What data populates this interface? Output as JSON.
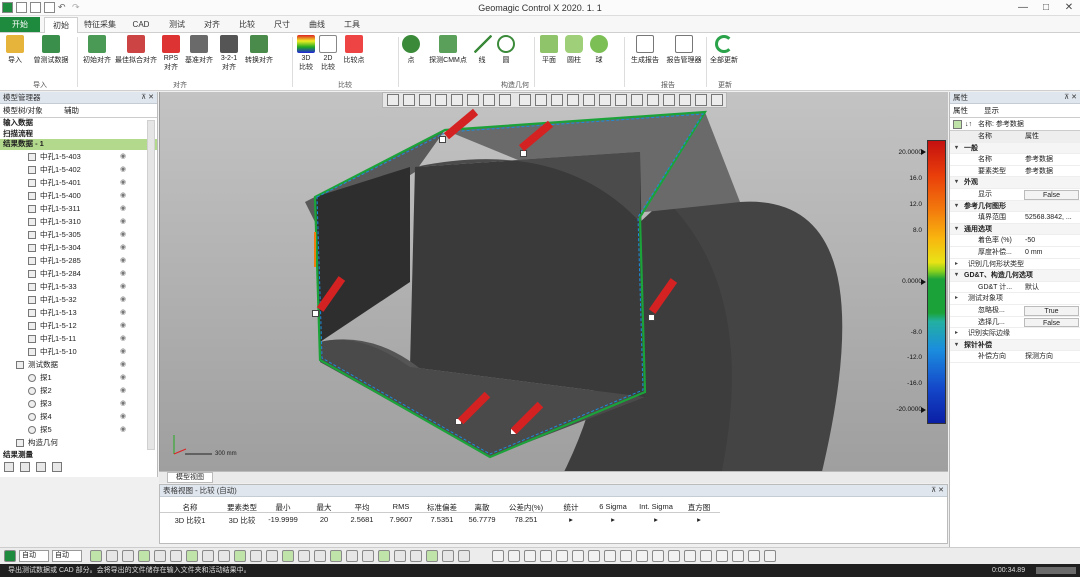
{
  "app": {
    "title": "Geomagic Control X 2020. 1. 1"
  },
  "menu": {
    "tabs": [
      "开始",
      "初始",
      "特征采集",
      "CAD",
      "测试",
      "对齐",
      "比较",
      "尺寸",
      "曲线",
      "工具"
    ],
    "active": "初始"
  },
  "ribbon": {
    "buttons": [
      {
        "label": "导入"
      },
      {
        "label": "曾测试数据"
      },
      {
        "label": "初始对齐"
      },
      {
        "label": "最佳拟合对齐"
      },
      {
        "label": "RPS\n对齐"
      },
      {
        "label": "基准对齐"
      },
      {
        "label": "3-2-1\n对齐"
      },
      {
        "label": "转换对齐"
      },
      {
        "label": "3D\n比较"
      },
      {
        "label": "2D\n比较"
      },
      {
        "label": "比较点"
      },
      {
        "label": "点"
      },
      {
        "label": "探测CMM点"
      },
      {
        "label": "线"
      },
      {
        "label": "圆"
      },
      {
        "label": "平面"
      },
      {
        "label": "圆柱"
      },
      {
        "label": "球"
      },
      {
        "label": "生成报告"
      },
      {
        "label": "报告管理器"
      },
      {
        "label": "全部更新"
      }
    ],
    "groups": [
      "导入",
      "对齐",
      "比较",
      "构造几何",
      "报告",
      "更新"
    ]
  },
  "left_panel": {
    "title": "模型管理器",
    "tab_model": "模型树/对象",
    "tab_assist": "辅助",
    "sections": {
      "input": "输入数据",
      "scan": "扫描流程",
      "result": "结果数据 - 1"
    },
    "items": [
      "中孔1-5-403",
      "中孔1-5-402",
      "中孔1-5-401",
      "中孔1-5-400",
      "中孔1-5-311",
      "中孔1-5-310",
      "中孔1-5-305",
      "中孔1-5-304",
      "中孔1-5-285",
      "中孔1-5-284",
      "中孔1-5-33",
      "中孔1-5-32",
      "中孔1-5-13",
      "中孔1-5-12",
      "中孔1-5-11",
      "中孔1-5-10"
    ],
    "test_data": "测试数据",
    "test_items": [
      "探1",
      "探2",
      "探3",
      "探4",
      "探5"
    ],
    "constr": "构造几何",
    "result_cmp": "结果测量"
  },
  "viewport": {
    "scale_label": "300 mm",
    "tab_label": "模型视图"
  },
  "colorbar": {
    "max": "20.0000",
    "t1": "16.0",
    "t2": "12.0",
    "t3": "8.0",
    "zero": "0.0000",
    "t4": "-8.0",
    "t5": "-12.0",
    "t6": "-16.0",
    "min": "-20.0000"
  },
  "right_panel": {
    "title": "属性",
    "tab_attr": "属性",
    "tab_display": "显示",
    "sub_label": "名称: 参考数据",
    "col_name": "名称",
    "col_attr": "属性",
    "rows": [
      {
        "kind": "cat",
        "k": "一般"
      },
      {
        "kind": "row",
        "k": "名称",
        "v": "参考数据"
      },
      {
        "kind": "row",
        "k": "要素类型",
        "v": "参考数据"
      },
      {
        "kind": "cat",
        "k": "外观"
      },
      {
        "kind": "box",
        "k": "显示",
        "v": "False"
      },
      {
        "kind": "cat",
        "k": "参考几何图形"
      },
      {
        "kind": "row",
        "k": "填界范围",
        "v": "52568.3842, ..."
      },
      {
        "kind": "cat",
        "k": "通用选项"
      },
      {
        "kind": "row",
        "k": "着色率 (%)",
        "v": "-50"
      },
      {
        "kind": "row",
        "k": "厚度补偿...",
        "v": "0 mm"
      },
      {
        "kind": "sub",
        "k": "识别几何形状类型"
      },
      {
        "kind": "cat",
        "k": "GD&T、构造几何选项"
      },
      {
        "kind": "row",
        "k": "GD&T 计...",
        "v": "默认"
      },
      {
        "kind": "sub",
        "k": "测试对象项"
      },
      {
        "kind": "box",
        "k": "忽略极...",
        "v": "True"
      },
      {
        "kind": "box",
        "k": "选择几...",
        "v": "False"
      },
      {
        "kind": "sub",
        "k": "识别实际边缘"
      },
      {
        "kind": "cat",
        "k": "探针补偿"
      },
      {
        "kind": "row",
        "k": "补偿方向",
        "v": "探测方向"
      }
    ]
  },
  "table": {
    "title": "表格视图 - 比较 (自动)",
    "headers": [
      "名称",
      "要素类型",
      "最小",
      "最大",
      "平均",
      "RMS",
      "标准偏差",
      "离散",
      "公差内(%)",
      "统计",
      "6 Sigma",
      "Int. Sigma",
      "直方图"
    ],
    "row": [
      "3D 比较1",
      "3D 比较",
      "-19.9999",
      "20",
      "2.5681",
      "7.9607",
      "7.5351",
      "56.7779",
      "78.251",
      "▸",
      "▸",
      "▸",
      "▸"
    ]
  },
  "bottom_toolbar": {
    "mode1": "自动",
    "mode2": "自动"
  },
  "status": {
    "message": "导出测试数据或 CAD 部分。会将导出的文件储存在输入文件夹和活动结果中。",
    "time": "0:00:34.89"
  }
}
